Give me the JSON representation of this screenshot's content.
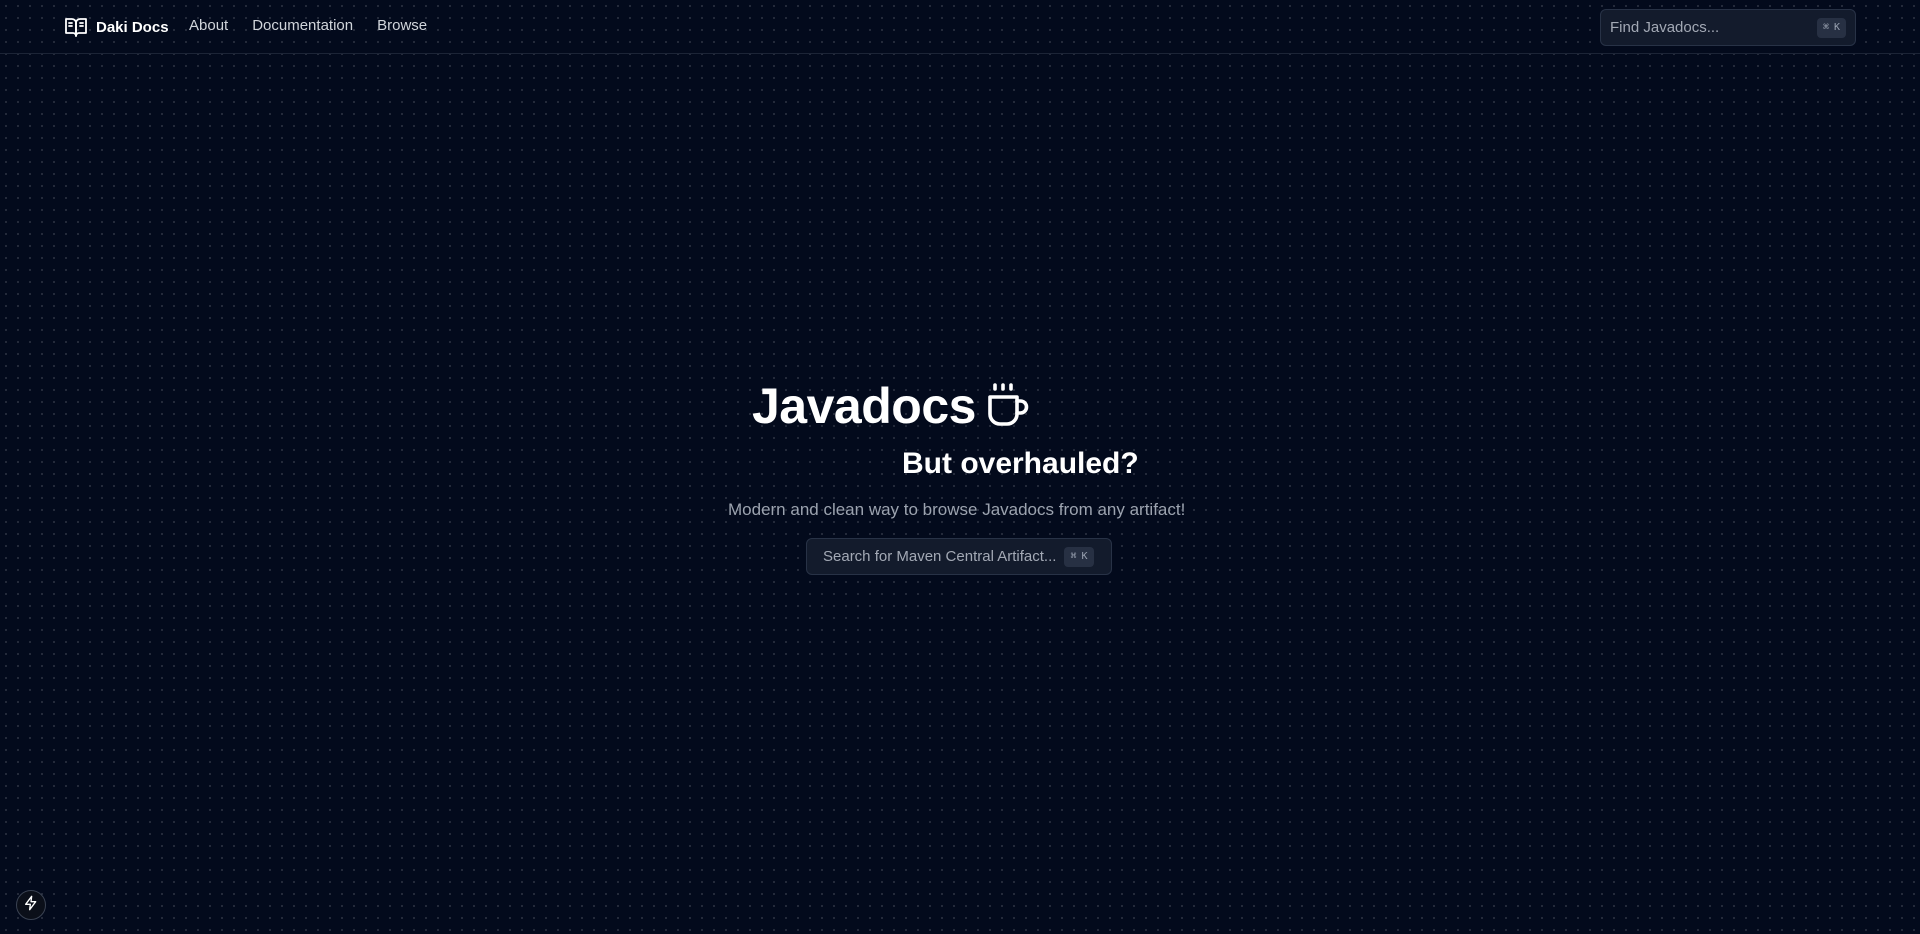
{
  "nav": {
    "brand": "Daki Docs",
    "brand_icon": "open-book-icon",
    "links": [
      "About",
      "Documentation",
      "Browse"
    ]
  },
  "find_search": {
    "placeholder": "Find Javadocs...",
    "shortcut_modifier": "⌘",
    "shortcut_key": "K"
  },
  "hero": {
    "title": "Javadocs",
    "title_icon": "coffee-cup-icon",
    "subtitle": "But overhauled?",
    "description": "Modern and clean way to browse Javadocs from any artifact!",
    "search_placeholder": "Search for Maven Central Artifact...",
    "shortcut_modifier": "⌘",
    "shortcut_key": "K"
  },
  "dev_badge": {
    "icon": "lightning-bolt-icon"
  },
  "colors": {
    "background": "#030a1c",
    "input_background": "#131b2c",
    "border": "#283246",
    "text_primary": "#ffffff",
    "text_muted": "#9ca3af"
  }
}
